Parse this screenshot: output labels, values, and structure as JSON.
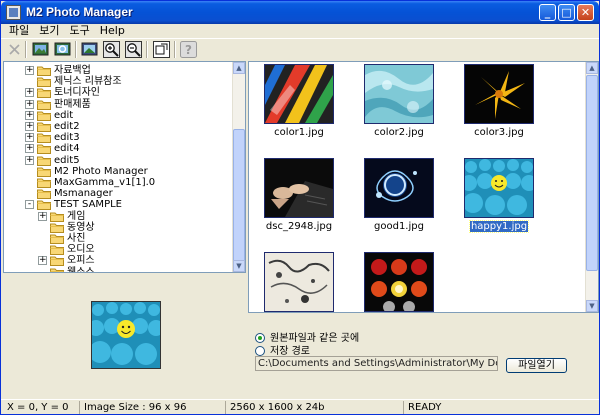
{
  "window": {
    "title": "M2 Photo Manager",
    "min_glyph": "_",
    "max_glyph": "□",
    "close_glyph": "✕"
  },
  "menu": [
    "파일",
    "보기",
    "도구",
    "Help"
  ],
  "toolbar": [
    {
      "name": "delete-icon",
      "enabled": false
    },
    {
      "name": "image-open-icon",
      "enabled": true
    },
    {
      "name": "image-refresh-icon",
      "enabled": true
    },
    {
      "name": "image-view-icon",
      "enabled": true
    },
    {
      "name": "zoom-in-icon",
      "enabled": true
    },
    {
      "name": "zoom-out-icon",
      "enabled": true
    },
    {
      "name": "fit-window-icon",
      "enabled": true
    },
    {
      "name": "help-icon",
      "enabled": false
    }
  ],
  "tree": {
    "items": [
      {
        "label": "자료백업",
        "level": 0,
        "expander": "+"
      },
      {
        "label": "제닉스 리뷰참조",
        "level": 0,
        "expander": ""
      },
      {
        "label": "토너디자인",
        "level": 0,
        "expander": "+"
      },
      {
        "label": "판매제품",
        "level": 0,
        "expander": "+"
      },
      {
        "label": "edit",
        "level": 0,
        "expander": "+"
      },
      {
        "label": "edit2",
        "level": 0,
        "expander": "+"
      },
      {
        "label": "edit3",
        "level": 0,
        "expander": "+"
      },
      {
        "label": "edit4",
        "level": 0,
        "expander": "+"
      },
      {
        "label": "edit5",
        "level": 0,
        "expander": "+"
      },
      {
        "label": "M2 Photo Manager",
        "level": 0,
        "expander": ""
      },
      {
        "label": "MaxGamma_v1[1].0",
        "level": 0,
        "expander": ""
      },
      {
        "label": "Msmanager",
        "level": 0,
        "expander": ""
      },
      {
        "label": "TEST SAMPLE",
        "level": 0,
        "expander": "-"
      },
      {
        "label": "게임",
        "level": 1,
        "expander": "+"
      },
      {
        "label": "동영상",
        "level": 1,
        "expander": ""
      },
      {
        "label": "사진",
        "level": 1,
        "expander": ""
      },
      {
        "label": "오디오",
        "level": 1,
        "expander": ""
      },
      {
        "label": "오피스",
        "level": 1,
        "expander": "+"
      },
      {
        "label": "웹소스",
        "level": 1,
        "expander": ""
      }
    ]
  },
  "thumbnails": [
    {
      "label": "color1.jpg",
      "selected": false
    },
    {
      "label": "color2.jpg",
      "selected": false
    },
    {
      "label": "color3.jpg",
      "selected": false
    },
    {
      "label": "dsc_2948.jpg",
      "selected": false
    },
    {
      "label": "good1.jpg",
      "selected": false
    },
    {
      "label": "happy1.jpg",
      "selected": true
    },
    {
      "label": "",
      "selected": false
    },
    {
      "label": "",
      "selected": false
    }
  ],
  "save_options": {
    "option_same_folder": "원본파일과 같은 곳에",
    "option_save_path": "저장 경로",
    "selected": "same_folder",
    "path_value": "C:\\Documents and Settings\\Administrator\\My Documents",
    "open_button": "파일열기"
  },
  "status": {
    "coords": "X = 0, Y = 0",
    "image_size": "Image Size : 96 x 96",
    "dims": "2560  x  1600  x  24b",
    "state": "READY"
  },
  "colors": {
    "title_bar": "#0552d6",
    "selection": "#316ac5",
    "face": "#ece9d8"
  }
}
